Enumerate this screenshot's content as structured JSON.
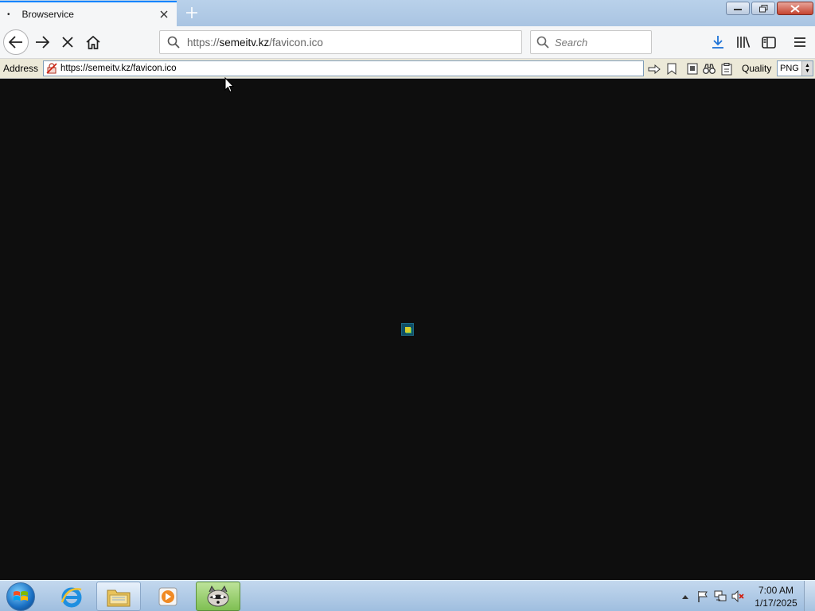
{
  "window": {
    "tab_title": "Browservice",
    "tab_dot": "•"
  },
  "navbar": {
    "url_prefix": "https://",
    "url_host": "semeitv.kz",
    "url_path": "/favicon.ico",
    "search_placeholder": "Search"
  },
  "address_toolbar": {
    "label": "Address",
    "url": "https://semeitv.kz/favicon.ico",
    "quality_label": "Quality",
    "quality_value": "PNG"
  },
  "taskbar": {
    "time": "7:00 AM",
    "date": "1/17/2025"
  },
  "colors": {
    "content_bg": "#0e0e0e",
    "favicon_bg": "#0f4f66",
    "favicon_fg": "#d6cf2c",
    "tab_accent": "#0a84ff"
  }
}
